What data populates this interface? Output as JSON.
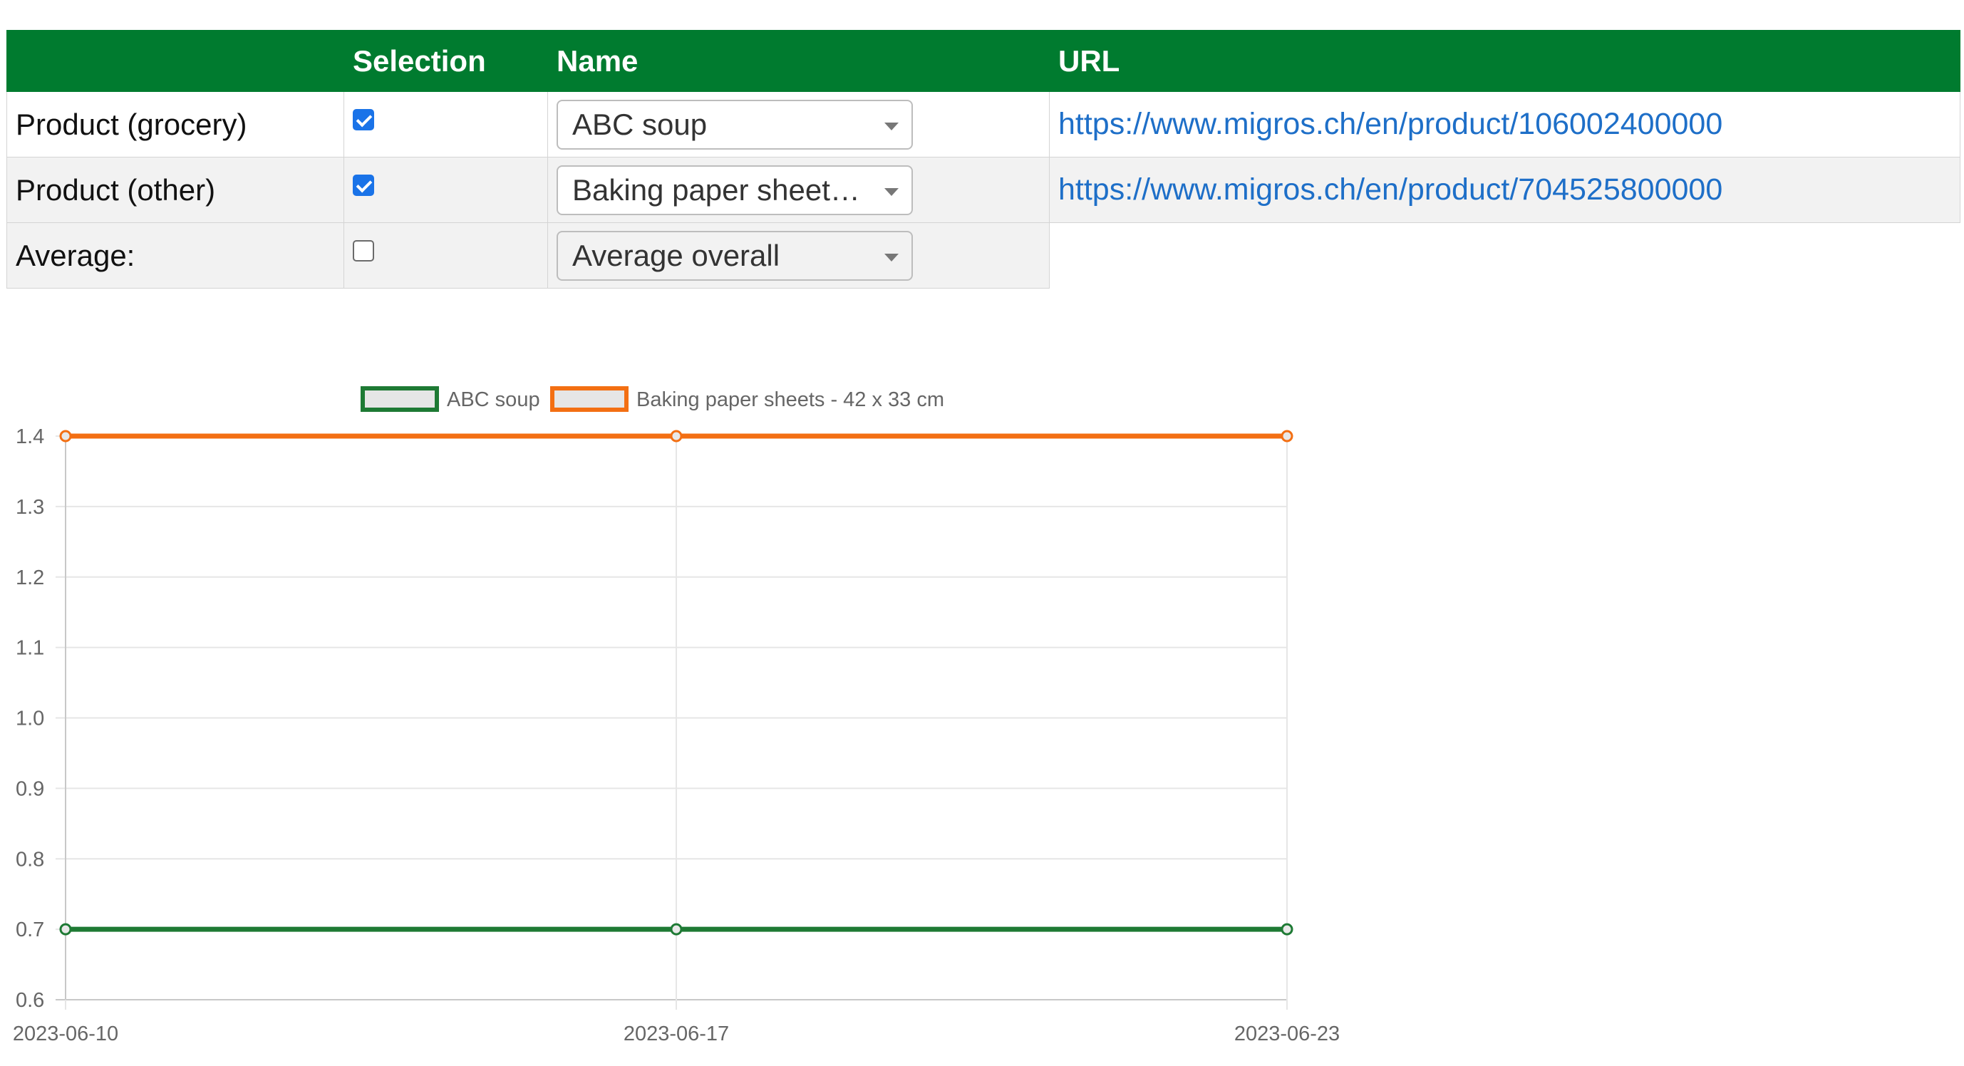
{
  "table": {
    "headers": {
      "blank": "",
      "selection": "Selection",
      "name": "Name",
      "url": "URL"
    },
    "rows": [
      {
        "label": "Product (grocery)",
        "checked": true,
        "name": "ABC soup",
        "url": "https://www.migros.ch/en/product/106002400000"
      },
      {
        "label": "Product (other)",
        "checked": true,
        "name": "Baking paper sheet…",
        "url": "https://www.migros.ch/en/product/704525800000"
      },
      {
        "label": "Average:",
        "checked": false,
        "name": "Average overall",
        "url": ""
      }
    ]
  },
  "colors": {
    "header_bg": "#007b2f",
    "link": "#1e6fc8",
    "series_green": "#1e7a34",
    "series_orange": "#f36f13"
  },
  "chart_data": {
    "type": "line",
    "x": [
      "2023-06-10",
      "2023-06-17",
      "2023-06-23"
    ],
    "ylim": [
      0.6,
      1.4
    ],
    "yticks": [
      "0.6",
      "0.7",
      "0.8",
      "0.9",
      "1.0",
      "1.1",
      "1.2",
      "1.3",
      "1.4"
    ],
    "grid": true,
    "legend": "top",
    "series": [
      {
        "name": "ABC soup",
        "values": [
          0.7,
          0.7,
          0.7
        ],
        "color": "#1e7a34"
      },
      {
        "name": "Baking paper sheets - 42 x 33 cm",
        "values": [
          1.4,
          1.4,
          1.4
        ],
        "color": "#f36f13"
      }
    ]
  }
}
